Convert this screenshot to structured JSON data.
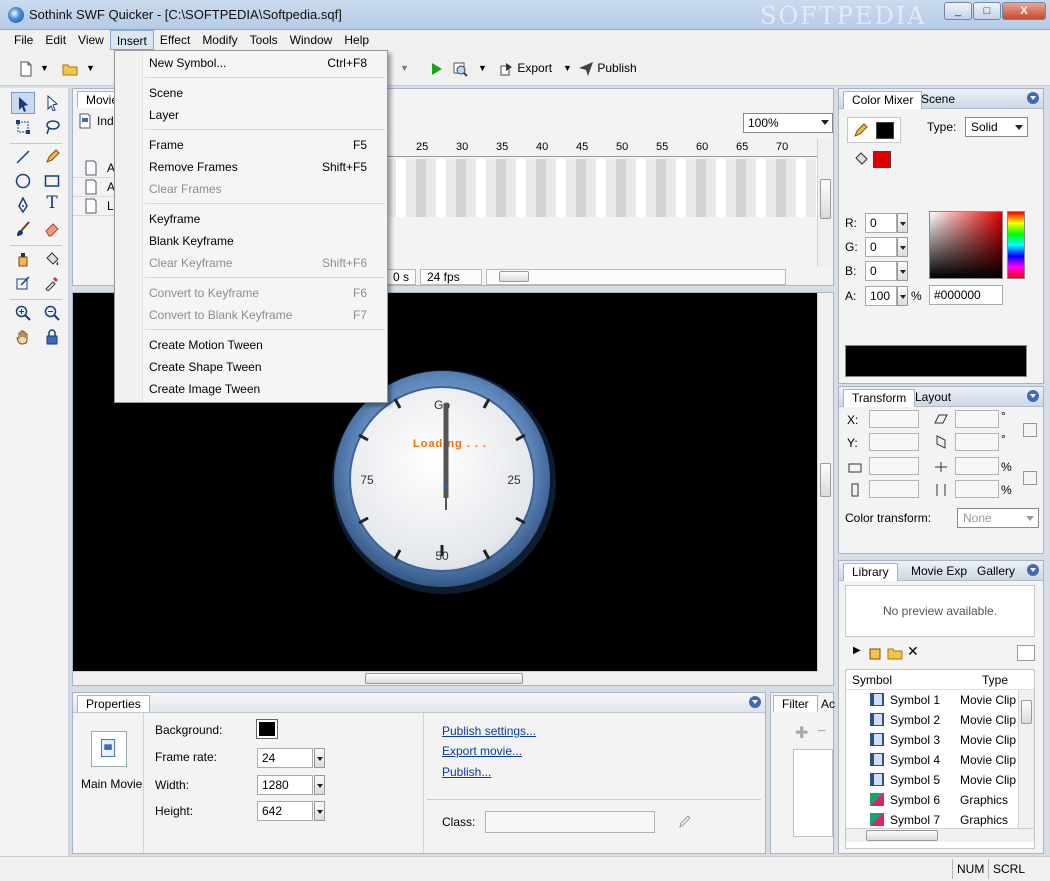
{
  "window": {
    "title": "Sothink SWF Quicker - [C:\\SOFTPEDIA\\Softpedia.sqf]",
    "min": "_",
    "max": "□",
    "close": "X",
    "watermark": "SOFTPEDIA"
  },
  "menu": {
    "items": [
      "File",
      "Edit",
      "View",
      "Insert",
      "Effect",
      "Modify",
      "Tools",
      "Window",
      "Help"
    ]
  },
  "toolbar": {
    "export_label": "Export",
    "publish_label": "Publish"
  },
  "insert_menu": {
    "items": [
      {
        "label": "New Symbol...",
        "shortcut": "Ctrl+F8",
        "disabled": false
      },
      {
        "label": "Scene",
        "shortcut": "",
        "disabled": false
      },
      {
        "label": "Layer",
        "shortcut": "",
        "disabled": false
      },
      {
        "label": "Frame",
        "shortcut": "F5",
        "disabled": false
      },
      {
        "label": "Remove Frames",
        "shortcut": "Shift+F5",
        "disabled": false
      },
      {
        "label": "Clear Frames",
        "shortcut": "",
        "disabled": true
      },
      {
        "label": "Keyframe",
        "shortcut": "",
        "disabled": false
      },
      {
        "label": "Blank Keyframe",
        "shortcut": "",
        "disabled": false
      },
      {
        "label": "Clear Keyframe",
        "shortcut": "Shift+F6",
        "disabled": true
      },
      {
        "label": "Convert to Keyframe",
        "shortcut": "F6",
        "disabled": true
      },
      {
        "label": "Convert to Blank Keyframe",
        "shortcut": "F7",
        "disabled": true
      },
      {
        "label": "Create Motion Tween",
        "shortcut": "",
        "disabled": false
      },
      {
        "label": "Create Shape Tween",
        "shortcut": "",
        "disabled": false
      },
      {
        "label": "Create Image Tween",
        "shortcut": "",
        "disabled": false
      }
    ]
  },
  "timeline": {
    "tab_label": "Movie",
    "index_label": "Ind",
    "zoom": "100%",
    "ruler": [
      "25",
      "30",
      "35",
      "40",
      "45",
      "50",
      "55",
      "60",
      "65",
      "70"
    ],
    "layers": [
      "A",
      "A",
      "L"
    ],
    "time": "0 s",
    "fps": "24 fps"
  },
  "stage": {
    "clock_numbers": {
      "top": "Go",
      "right": "25",
      "bottom": "50",
      "left": "75"
    },
    "loading_text": "Loading . . ."
  },
  "properties": {
    "tab": "Properties",
    "object_label": "Main Movie",
    "background_label": "Background:",
    "frame_rate_label": "Frame rate:",
    "frame_rate": "24",
    "width_label": "Width:",
    "width": "1280",
    "height_label": "Height:",
    "height": "642",
    "links": [
      "Publish settings...",
      "Export movie...",
      "Publish..."
    ],
    "class_label": "Class:"
  },
  "filter_panel": {
    "tab": "Filter",
    "tab2": "Ac"
  },
  "color_mixer": {
    "tab": "Color Mixer",
    "tab2": "Scene",
    "type_label": "Type:",
    "type_value": "Solid",
    "r_label": "R:",
    "r": "0",
    "g_label": "G:",
    "g": "0",
    "b_label": "B:",
    "b": "0",
    "a_label": "A:",
    "a": "100",
    "pct": "%",
    "hex": "#000000"
  },
  "transform": {
    "tab": "Transform",
    "tab2": "Layout",
    "x_label": "X:",
    "y_label": "Y:",
    "deg": "°",
    "pct": "%",
    "color_transform_label": "Color transform:",
    "color_transform_value": "None"
  },
  "library": {
    "tabs": [
      "Library",
      "Movie Exp",
      "Gallery"
    ],
    "preview": "No preview available.",
    "col_symbol": "Symbol",
    "col_type": "Type",
    "rows": [
      {
        "name": "Symbol 1",
        "type": "Movie Clip",
        "kind": "mc"
      },
      {
        "name": "Symbol 2",
        "type": "Movie Clip",
        "kind": "mc"
      },
      {
        "name": "Symbol 3",
        "type": "Movie Clip",
        "kind": "mc"
      },
      {
        "name": "Symbol 4",
        "type": "Movie Clip",
        "kind": "mc"
      },
      {
        "name": "Symbol 5",
        "type": "Movie Clip",
        "kind": "mc"
      },
      {
        "name": "Symbol 6",
        "type": "Graphics",
        "kind": "gfx"
      },
      {
        "name": "Symbol 7",
        "type": "Graphics",
        "kind": "gfx"
      }
    ]
  },
  "status": {
    "num": "NUM",
    "scrl": "SCRL"
  },
  "colors": {
    "accent": "#3f6ab5",
    "stroke": "#000000",
    "fill": "#e00000",
    "loading": "#ff6a00"
  }
}
